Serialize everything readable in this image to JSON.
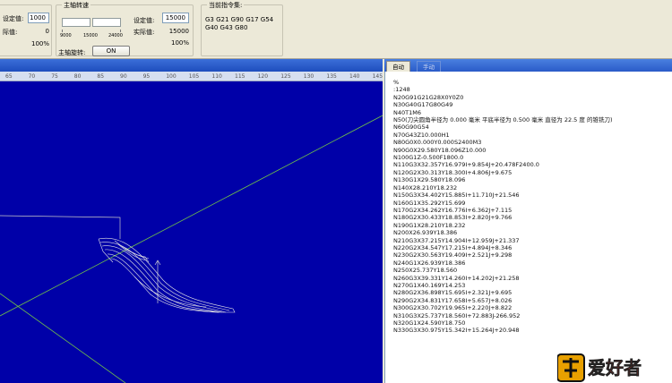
{
  "panel_left": {
    "set_label": "设定值:",
    "set_value": "1000",
    "actual_label": "际值:",
    "actual_value": "0",
    "percent": "100%"
  },
  "spindle": {
    "title": "主轴转速",
    "ticks": [
      "9000",
      "15000",
      "24000"
    ],
    "set_label": "设定值:",
    "set_value": "15000",
    "actual_label": "实际值:",
    "actual_value": "15000",
    "percent": "100%",
    "rotate_label": "主轴旋转:",
    "rotate_button": "ON"
  },
  "commands": {
    "title": "当前指令集:",
    "text": "G3 G21 G90 G17 G54 G40 G43 G80"
  },
  "ruler_ticks": [
    "65",
    "70",
    "75",
    "80",
    "85",
    "90",
    "95",
    "100",
    "105",
    "110",
    "115",
    "120",
    "125",
    "130",
    "135",
    "140",
    "145"
  ],
  "tabs": {
    "active": "自动",
    "inactive": "手动"
  },
  "code_lines": [
    "%",
    ":1248",
    "N20G91G21G28X0Y0Z0",
    "N30G40G17G80G49",
    "N40T1M6",
    "N50(刀尖圆角半径为 0.000 毫米 平底半径为 0.500 毫米 直径为 22.5 度 的锥铣刀)",
    "N60G90G54",
    "N70G43Z10.000H1",
    "N80G0X0.000Y0.000S2400M3",
    "N90G0X29.580Y18.096Z10.000",
    "N100G1Z-0.500F1800.0",
    "N110G3X32.357Y16.979I+9.854J+20.478F2400.0",
    "N120G2X30.313Y18.300I+4.806J+9.675",
    "N130G1X29.580Y18.096",
    "N140X28.210Y18.232",
    "N150G3X34.402Y15.885I+11.710J+21.546",
    "N160G1X35.292Y15.699",
    "N170G2X34.262Y16.776I+6.362J+7.115",
    "N180G2X30.433Y18.853I+2.820J+9.766",
    "N190G1X28.210Y18.232",
    "N200X26.939Y18.386",
    "N210G3X37.215Y14.904I+12.959J+21.337",
    "N220G2X34.547Y17.215I+4.894J+8.346",
    "N230G2X30.563Y19.409I+2.521J+9.298",
    "N240G1X26.939Y18.386",
    "N250X25.737Y18.560",
    "N260G3X39.331Y14.260I+14.202J+21.258",
    "N270G1X40.169Y14.253",
    "N280G2X36.898Y15.695I+2.321J+9.695",
    "N290G2X34.831Y17.658I+5.657J+8.026",
    "N300G2X30.702Y19.965I+2.220J+8.822",
    "N310G3X25.737Y18.560I+72.883J-266.952",
    "N320G1X24.590Y18.750",
    "N330G3X30.975Y15.342I+15.264J+20.948"
  ],
  "logo_text": "爱好者",
  "colors": {
    "viewport_bg": "#0000a8",
    "toolpath": "#e6e6e6",
    "axis_line": "#6fbf4a"
  }
}
